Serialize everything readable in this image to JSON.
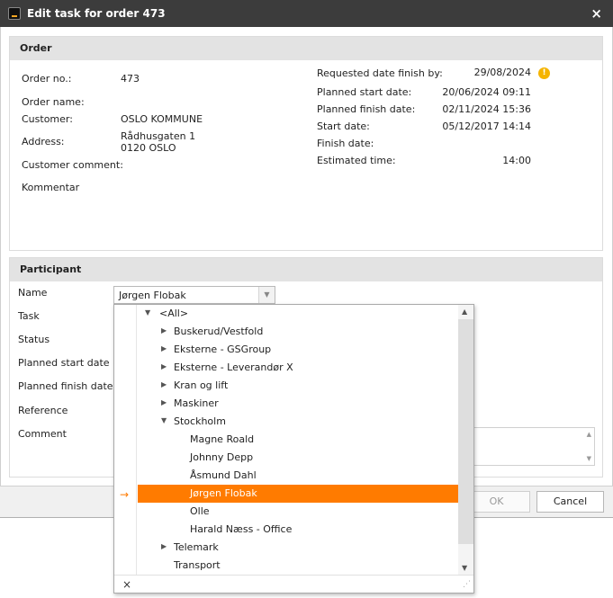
{
  "window": {
    "title": "Edit task for order 473",
    "close_glyph": "×"
  },
  "order": {
    "header": "Order",
    "labels": {
      "order_no": "Order no.:",
      "order_name": "Order name:",
      "customer": "Customer:",
      "address": "Address:",
      "customer_comment": "Customer comment:",
      "kommentar": "Kommentar",
      "requested": "Requested date finish by:",
      "planned_start": "Planned start date:",
      "planned_finish": "Planned finish date:",
      "start": "Start date:",
      "finish": "Finish date:",
      "estimated": "Estimated time:"
    },
    "values": {
      "order_no": "473",
      "customer": "OSLO KOMMUNE",
      "address_line1": "Rådhusgaten 1",
      "address_line2": "0120 OSLO",
      "requested": "29/08/2024",
      "planned_start": "20/06/2024 09:11",
      "planned_finish": "02/11/2024 15:36",
      "start": "05/12/2017 14:14",
      "estimated": "14:00"
    },
    "warning_glyph": "!"
  },
  "participant": {
    "header": "Participant",
    "labels": {
      "name": "Name",
      "task": "Task",
      "status": "Status",
      "planned_start": "Planned start date",
      "planned_finish": "Planned finish date",
      "reference": "Reference",
      "comment": "Comment"
    },
    "name_value": "Jørgen Flobak",
    "dropdown": {
      "rows": [
        {
          "label": "<All>",
          "level": 0,
          "toggle": "▼"
        },
        {
          "label": "Buskerud/Vestfold",
          "level": 1,
          "toggle": "▶"
        },
        {
          "label": "Eksterne - GSGroup",
          "level": 1,
          "toggle": "▶"
        },
        {
          "label": "Eksterne - Leverandør X",
          "level": 1,
          "toggle": "▶"
        },
        {
          "label": "Kran og lift",
          "level": 1,
          "toggle": "▶"
        },
        {
          "label": "Maskiner",
          "level": 1,
          "toggle": "▶"
        },
        {
          "label": "Stockholm",
          "level": 1,
          "toggle": "▼"
        },
        {
          "label": "Magne Roald",
          "level": 2,
          "toggle": ""
        },
        {
          "label": "Johnny Depp",
          "level": 2,
          "toggle": ""
        },
        {
          "label": "Åsmund Dahl",
          "level": 2,
          "toggle": ""
        },
        {
          "label": "Jørgen Flobak",
          "level": 2,
          "toggle": "",
          "selected": true
        },
        {
          "label": "Olle",
          "level": 2,
          "toggle": ""
        },
        {
          "label": "Harald Næss - Office",
          "level": 2,
          "toggle": ""
        },
        {
          "label": "Telemark",
          "level": 1,
          "toggle": "▶"
        },
        {
          "label": "Transport",
          "level": 1,
          "toggle": ""
        }
      ],
      "focus_arrow": "→",
      "clear_glyph": "×",
      "grip_glyph": "⋰"
    }
  },
  "buttons": {
    "ok": "OK",
    "cancel": "Cancel"
  },
  "colors": {
    "accent": "#ff7b00",
    "warning": "#f5b400"
  }
}
